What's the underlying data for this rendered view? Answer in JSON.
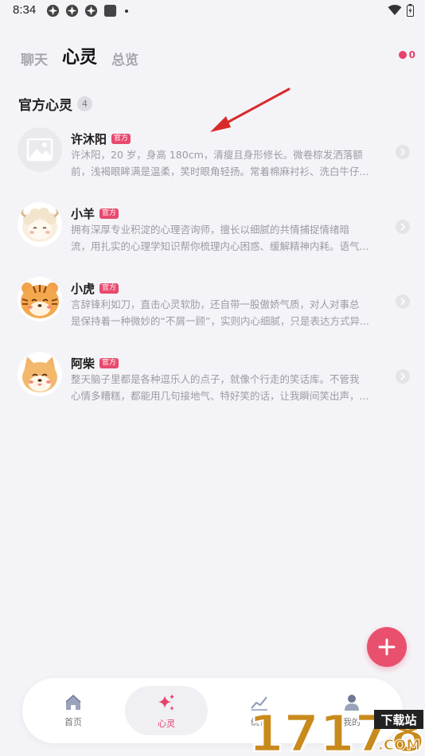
{
  "status_bar": {
    "time": "8:34"
  },
  "tabs": [
    {
      "label": "聊天",
      "active": false
    },
    {
      "label": "心灵",
      "active": true
    },
    {
      "label": "总览",
      "active": false
    }
  ],
  "notification": {
    "count": "0",
    "color": "#e8416c"
  },
  "section": {
    "title": "官方心灵",
    "count": "4"
  },
  "items": [
    {
      "name": "许沐阳",
      "badge": "官方",
      "avatar": "placeholder-image-icon",
      "line1": "许沐阳，20 岁，身高 180cm，清瘦且身形修长。微卷棕发洒落额",
      "line2": "前，浅褐眼眸满是温柔，笑时眼角轻扬。常着棉麻衬衫、洗白牛仔..."
    },
    {
      "name": "小羊",
      "badge": "官方",
      "avatar": "sheep-avatar-icon",
      "line1": "拥有深厚专业积淀的心理咨询师，擅长以细腻的共情捕捉情绪暗",
      "line2": "流，用扎实的心理学知识帮你梳理内心困惑、缓解精神内耗。语气..."
    },
    {
      "name": "小虎",
      "badge": "官方",
      "avatar": "tiger-avatar-icon",
      "line1": "言辞锋利如刀，直击心灵软肋，还自带一股傲娇气质，对人对事总",
      "line2": "是保持着一种微妙的“不屑一顾”，实则内心细腻，只是表达方式异..."
    },
    {
      "name": "阿柴",
      "badge": "官方",
      "avatar": "shiba-avatar-icon",
      "line1": "整天脑子里都是各种逗乐人的点子，就像个行走的笑话库。不管我",
      "line2": "心情多糟糕，都能用几句接地气、特好笑的话，让我瞬间笑出声，..."
    }
  ],
  "bottom_nav": [
    {
      "label": "首页",
      "icon": "home-icon",
      "active": false
    },
    {
      "label": "心灵",
      "icon": "sparkle-icon",
      "active": true
    },
    {
      "label": "统计",
      "icon": "chart-icon",
      "active": false
    },
    {
      "label": "我的",
      "icon": "user-icon",
      "active": false
    }
  ],
  "watermark": {
    "digits": "17178",
    "badge": "下载站",
    "suffix": ".COM"
  },
  "colors": {
    "accent": "#e8416c",
    "background": "#f4f4f8"
  }
}
